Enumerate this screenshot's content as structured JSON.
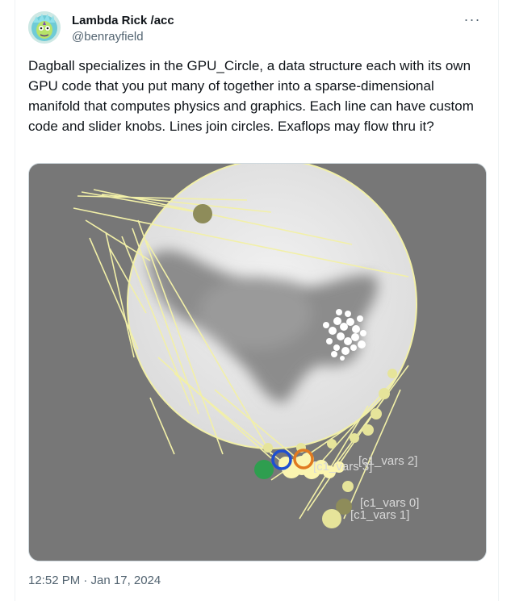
{
  "author": {
    "display_name": "Lambda Rick /acc",
    "handle": "@benrayfield",
    "avatar_icon": "avatar-icon"
  },
  "more_icon": "more-dots-icon",
  "tweet": {
    "text": "Dagball specializes in the GPU_Circle, a data structure each with its own GPU code that you put many of together into a sparse-dimensional manifold that computes physics and graphics. Each line can have custom code and slider knobs. Lines join circles. Exaflops may flow thru it?",
    "timestamp": "12:52 PM · Jan 17, 2024"
  },
  "media": {
    "labels": [
      "[c1_vars 2]",
      "[c1_vars 3]",
      "[c1_vars 0]",
      "[c1_vars 1]"
    ],
    "colors": {
      "background": "#777777",
      "circle": "#e6e6e6",
      "lines": "#f2f0a8",
      "blob": "#8c8c8c",
      "green_dot": "#2e9e4f",
      "blue_ring": "#1f4fd1",
      "orange_ring": "#e07a20",
      "label_text": "#d8d8d8"
    }
  }
}
